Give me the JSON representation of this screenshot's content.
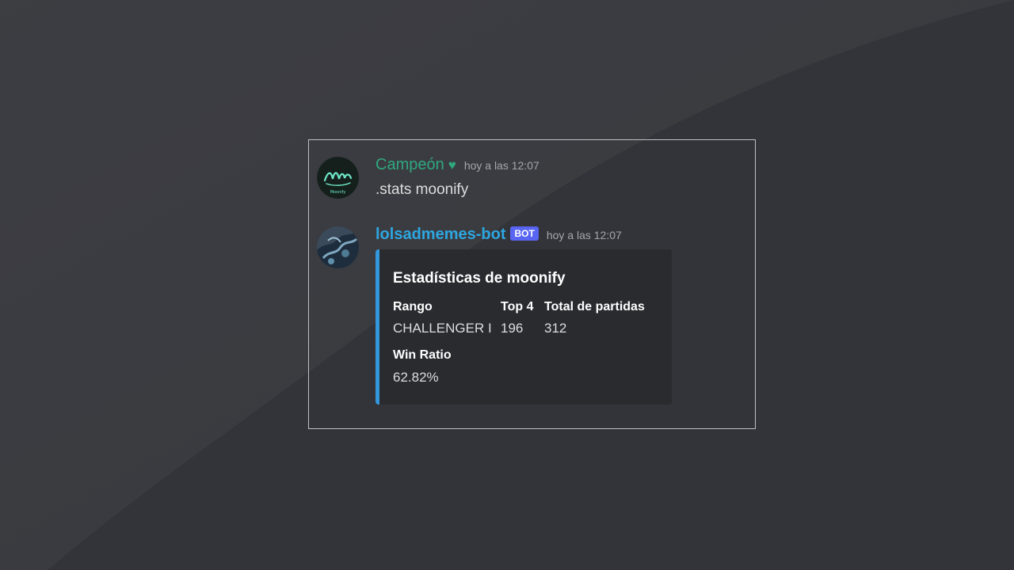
{
  "background": {
    "base_color": "#333439",
    "highlight_color": "#46474c"
  },
  "messages": [
    {
      "username": "Campeón",
      "username_color": "#2fa87d",
      "suffix_icon": "heart-icon",
      "suffix_glyph": "♥",
      "timestamp": "hoy a las 12:07",
      "text": ".stats moonify",
      "avatar_text": "Moonify"
    },
    {
      "username": "lolsadmemes-bot",
      "username_color": "#2ea6e0",
      "bot_tag": "BOT",
      "timestamp": "hoy a las 12:07",
      "embed": {
        "accent_color": "#3497db",
        "title": "Estadísticas de moonify",
        "fields": [
          {
            "name": "Rango",
            "value": "CHALLENGER I"
          },
          {
            "name": "Top 4",
            "value": "196"
          },
          {
            "name": "Total de partidas",
            "value": "312"
          },
          {
            "name": "Win Ratio",
            "value": "62.82%"
          }
        ]
      }
    }
  ]
}
